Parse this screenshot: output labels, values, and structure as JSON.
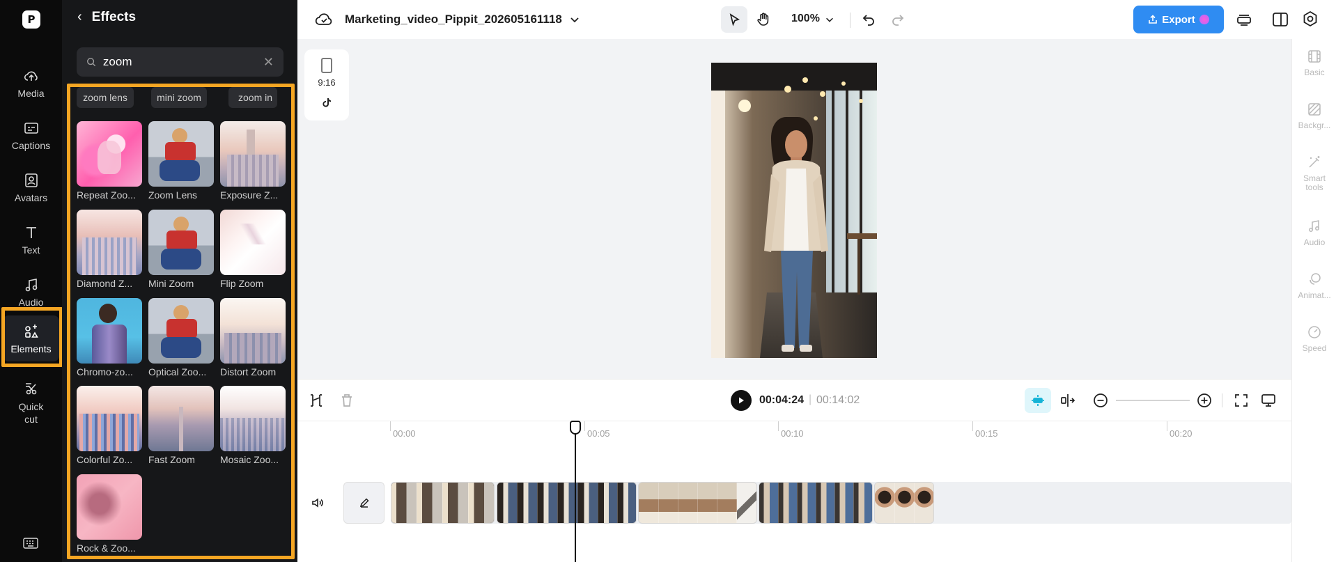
{
  "rail": {
    "items": [
      {
        "label": "Media",
        "icon": "cloud-upload-icon"
      },
      {
        "label": "Captions",
        "icon": "captions-icon"
      },
      {
        "label": "Avatars",
        "icon": "avatar-icon"
      },
      {
        "label": "Text",
        "icon": "text-icon"
      },
      {
        "label": "Audio",
        "icon": "music-note-icon"
      },
      {
        "label": "Elements",
        "icon": "elements-icon",
        "active": true
      },
      {
        "label": "Quick cut",
        "icon": "scissors-icon"
      }
    ]
  },
  "panel": {
    "title": "Effects",
    "search": {
      "value": "zoom",
      "placeholder": ""
    },
    "chips": [
      "zoom lens",
      "mini zoom",
      "zoom in"
    ],
    "tiles": [
      {
        "label": "Repeat Zoo..."
      },
      {
        "label": "Zoom Lens"
      },
      {
        "label": "Exposure Z..."
      },
      {
        "label": "Diamond Z..."
      },
      {
        "label": "Mini Zoom"
      },
      {
        "label": "Flip Zoom"
      },
      {
        "label": "Chromo-zo..."
      },
      {
        "label": "Optical Zoo..."
      },
      {
        "label": "Distort Zoom"
      },
      {
        "label": "Colorful Zo..."
      },
      {
        "label": "Fast Zoom"
      },
      {
        "label": "Mosaic Zoo..."
      },
      {
        "label": "Rock & Zoo..."
      }
    ]
  },
  "topbar": {
    "project_name": "Marketing_video_Pippit_202605161118",
    "zoom_level": "100%",
    "export_label": "Export"
  },
  "canvas": {
    "ratio_label": "9:16"
  },
  "props": {
    "items": [
      "Basic",
      "Backgr...",
      "Smart tools",
      "Audio",
      "Animat...",
      "Speed"
    ]
  },
  "timeline": {
    "current_time": "00:04:24",
    "total_time": "00:14:02",
    "ruler": [
      "00:00",
      "00:05",
      "00:10",
      "00:15",
      "00:20"
    ]
  },
  "colors": {
    "accent": "#2f8cf2",
    "highlight": "#f5a623",
    "rail_bg": "#0b0b0b",
    "panel_bg": "#161719"
  }
}
